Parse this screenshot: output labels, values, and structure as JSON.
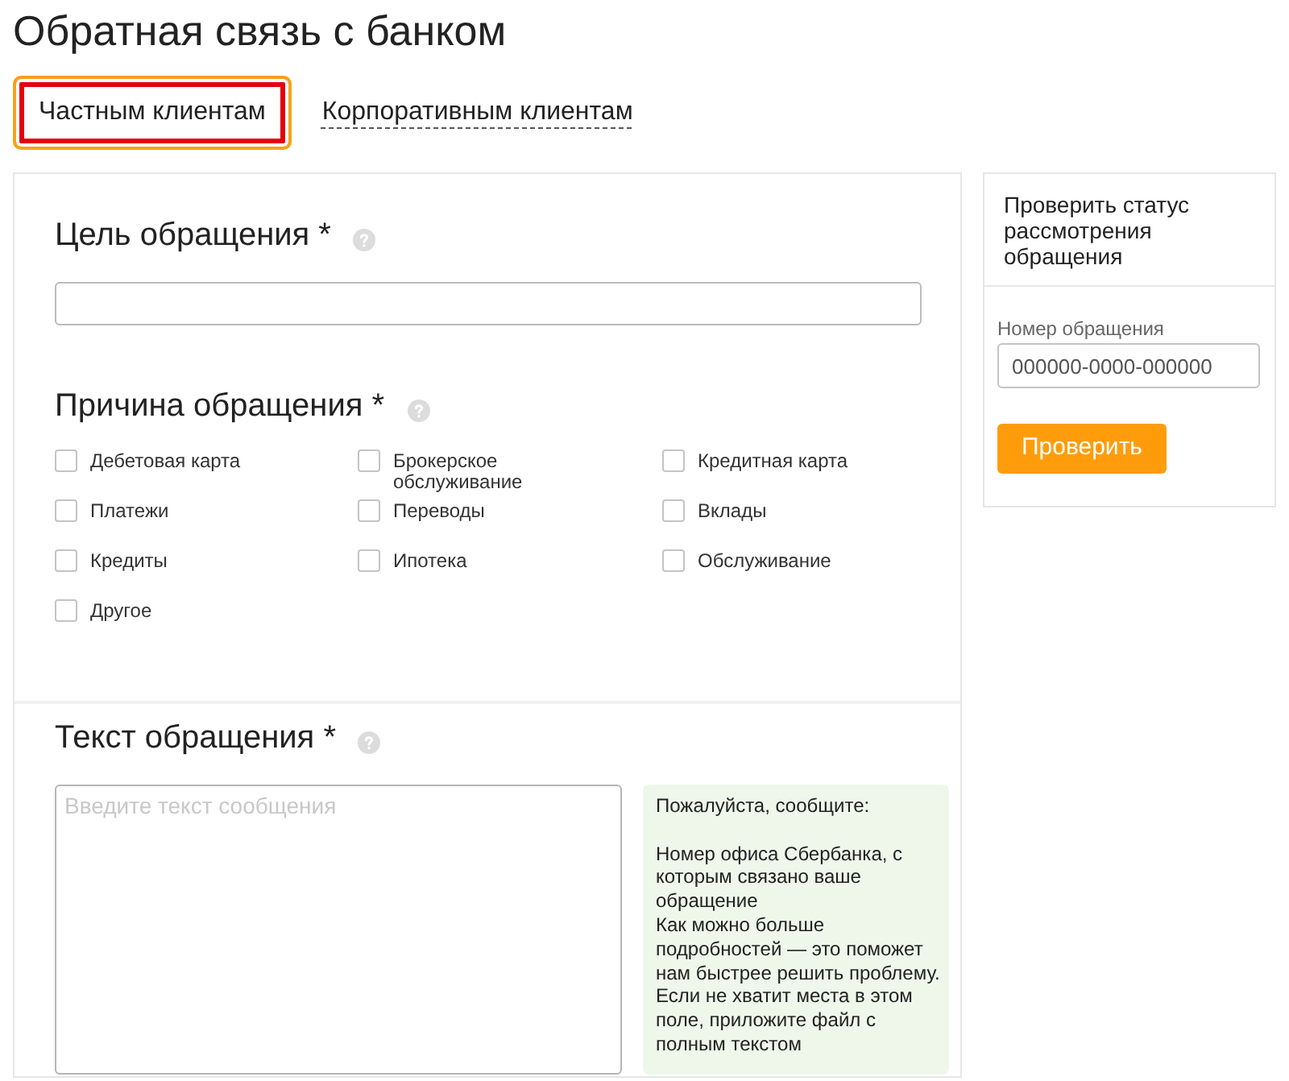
{
  "page": {
    "title": "Обратная связь с банком"
  },
  "tabs": [
    {
      "label": "Частным клиентам",
      "selected": true
    },
    {
      "label": "Корпоративным клиентам",
      "selected": false
    }
  ],
  "form": {
    "purpose": {
      "heading": "Цель обращения *"
    },
    "reason": {
      "heading": "Причина обращения *",
      "options": [
        {
          "label": "Дебетовая карта",
          "checked": false
        },
        {
          "label": "Брокерское обслуживание",
          "checked": false
        },
        {
          "label": "Кредитная карта",
          "checked": false
        },
        {
          "label": "Платежи",
          "checked": false
        },
        {
          "label": "Переводы",
          "checked": false
        },
        {
          "label": "Вклады",
          "checked": false
        },
        {
          "label": "Кредиты",
          "checked": false
        },
        {
          "label": "Ипотека",
          "checked": false
        },
        {
          "label": "Обслуживание",
          "checked": false
        },
        {
          "label": "Другое",
          "checked": false
        }
      ]
    },
    "message": {
      "heading": "Текст обращения *",
      "placeholder": "Введите текст сообщения",
      "hint": {
        "intro": "Пожалуйста, сообщите:",
        "items": [
          "Номер офиса Сбербанка, с которым связано ваше обращение",
          "Как можно больше подробностей — это поможет нам быстрее решить проблему.",
          "Если не хватит места в этом поле, приложите файл с полным текстом"
        ]
      }
    }
  },
  "status_check": {
    "title": "Проверить статус рассмотрения обращения",
    "field": {
      "label": "Номер обращения",
      "placeholder": "000000-0000-000000"
    },
    "button": "Проверить"
  }
}
